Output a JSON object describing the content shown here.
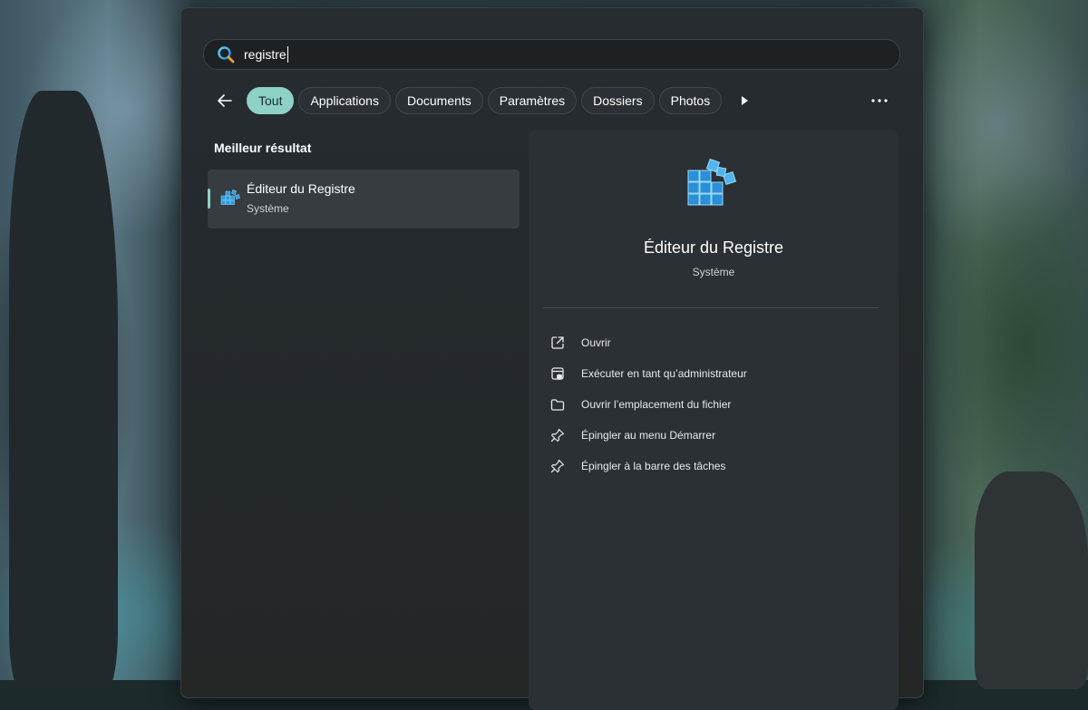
{
  "search": {
    "value": "registre"
  },
  "filters": {
    "items": [
      {
        "label": "Tout",
        "active": true
      },
      {
        "label": "Applications",
        "active": false
      },
      {
        "label": "Documents",
        "active": false
      },
      {
        "label": "Paramètres",
        "active": false
      },
      {
        "label": "Dossiers",
        "active": false
      },
      {
        "label": "Photos",
        "active": false
      }
    ]
  },
  "results": {
    "section_title": "Meilleur résultat",
    "best": {
      "title": "Éditeur du Registre",
      "subtitle": "Système",
      "icon": "registry-editor-icon"
    }
  },
  "details": {
    "title": "Éditeur du Registre",
    "subtitle": "Système",
    "actions": [
      {
        "label": "Ouvrir",
        "icon": "open-external-icon"
      },
      {
        "label": "Exécuter en tant qu’administrateur",
        "icon": "run-as-admin-icon"
      },
      {
        "label": "Ouvrir l’emplacement du fichier",
        "icon": "folder-icon"
      },
      {
        "label": "Épingler au menu Démarrer",
        "icon": "pin-icon"
      },
      {
        "label": "Épingler à la barre des tâches",
        "icon": "pin-icon"
      }
    ]
  },
  "colors": {
    "accent": "#8ed1c6",
    "panel": "#262c30",
    "registry_blue": "#2f9be0"
  }
}
